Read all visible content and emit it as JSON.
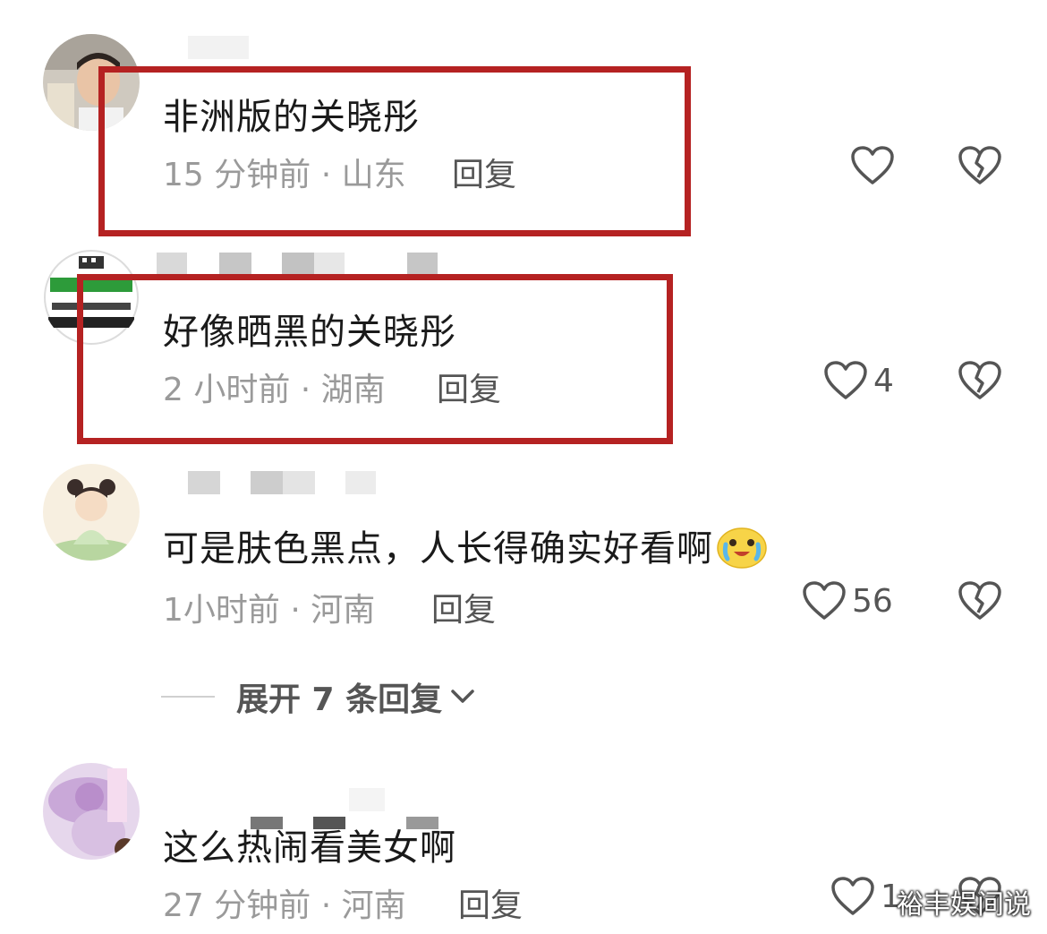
{
  "comments": [
    {
      "text": "非洲版的关晓彤",
      "meta": "15 分钟前 · 山东",
      "reply_label": "回复",
      "likes": ""
    },
    {
      "text": "好像晒黑的关晓彤",
      "meta": "2 小时前 · 湖南",
      "reply_label": "回复",
      "likes": "4"
    },
    {
      "text": "可是肤色黑点，人长得确实好看啊",
      "meta": "1小时前 · 河南",
      "reply_label": "回复",
      "likes": "56",
      "emoji": "crying-laughing-face"
    },
    {
      "text": "这么热闹看美女啊",
      "meta": "27 分钟前 · 河南",
      "reply_label": "回复",
      "likes": "1"
    }
  ],
  "expand_replies": {
    "label": "展开 7 条回复"
  },
  "watermark": "裕丰娱间说",
  "colors": {
    "highlight_box": "#b52222",
    "meta_text": "#9a9a9a",
    "body_text": "#1a1a1a"
  },
  "icons": [
    "heart-outline-icon",
    "broken-heart-icon",
    "chevron-down-icon"
  ]
}
